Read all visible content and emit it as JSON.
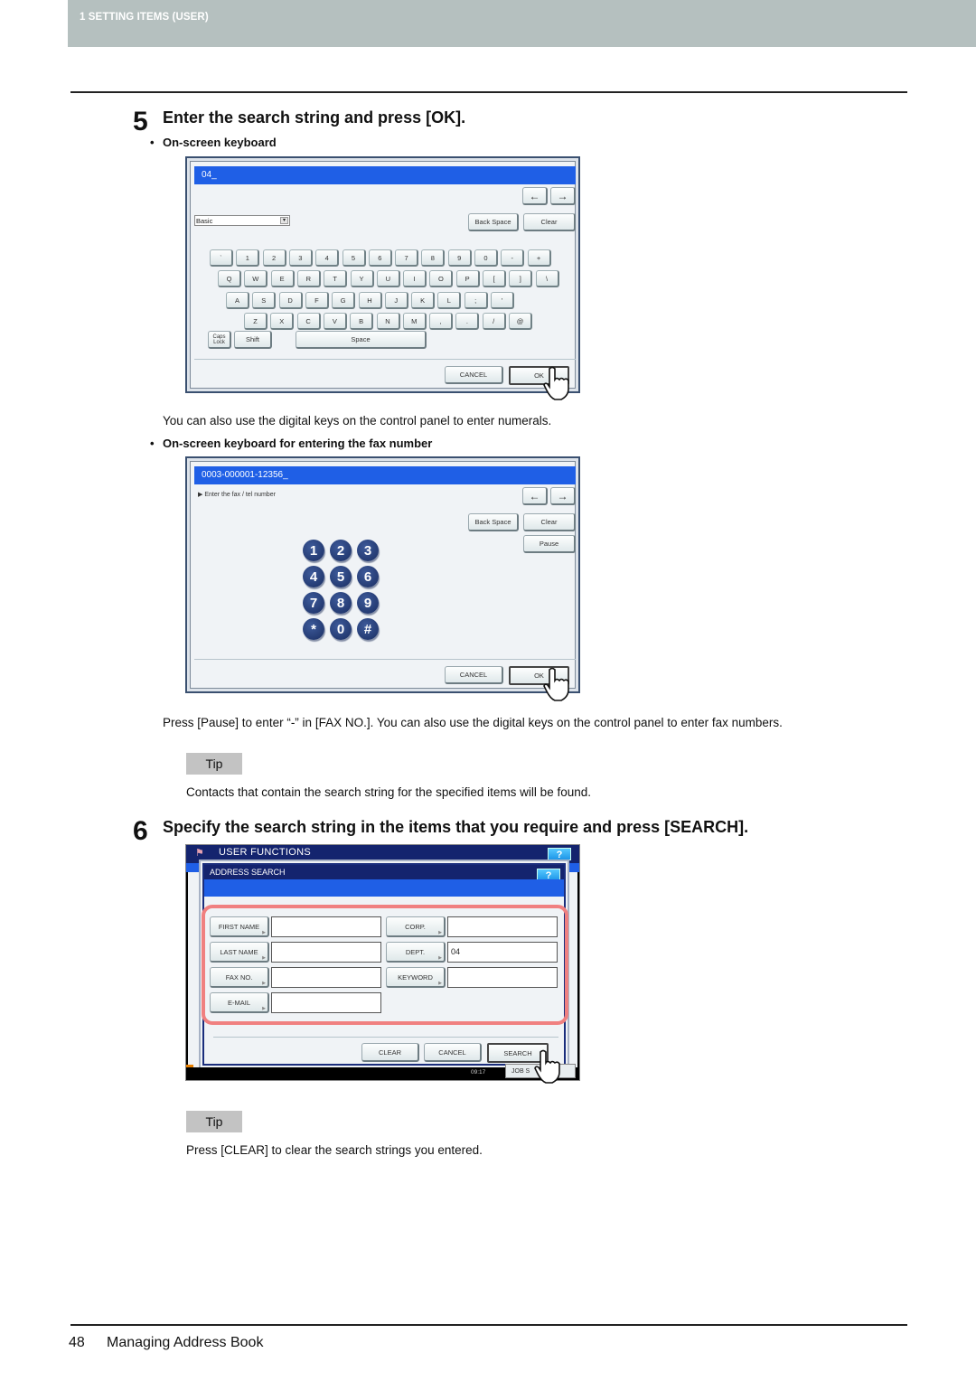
{
  "header": {
    "section": "1 SETTING ITEMS (USER)"
  },
  "step5": {
    "number": "5",
    "title": "Enter the search string and press [OK].",
    "bullet1": "On-screen keyboard",
    "keyboard": {
      "input_value": "04_",
      "mode_select": "Basic",
      "back_space": "Back Space",
      "clear": "Clear",
      "arrow_left": "←",
      "arrow_right": "→",
      "row1": [
        "`",
        "1",
        "2",
        "3",
        "4",
        "5",
        "6",
        "7",
        "8",
        "9",
        "0",
        "-",
        "+"
      ],
      "row2": [
        "Q",
        "W",
        "E",
        "R",
        "T",
        "Y",
        "U",
        "I",
        "O",
        "P",
        "[",
        "]",
        "\\"
      ],
      "row3": [
        "A",
        "S",
        "D",
        "F",
        "G",
        "H",
        "J",
        "K",
        "L",
        ";",
        "'"
      ],
      "row4": [
        "Z",
        "X",
        "C",
        "V",
        "B",
        "N",
        "M",
        ",",
        ".",
        "/",
        "@"
      ],
      "caps_lock": "Caps Lock",
      "shift": "Shift",
      "space": "Space",
      "cancel": "CANCEL",
      "ok": "OK"
    },
    "note1": "You can also use the digital keys on the control panel to enter numerals.",
    "bullet2": "On-screen keyboard for entering the fax number",
    "fax_keyboard": {
      "input_value": "0003-000001-12356_",
      "prompt": "Enter the fax / tel number",
      "back_space": "Back Space",
      "clear": "Clear",
      "pause": "Pause",
      "arrow_left": "←",
      "arrow_right": "→",
      "keys": [
        "1",
        "2",
        "3",
        "4",
        "5",
        "6",
        "7",
        "8",
        "9",
        "*",
        "0",
        "#"
      ],
      "cancel": "CANCEL",
      "ok": "OK"
    },
    "note2": "Press [Pause] to enter “-” in [FAX NO.]. You can also use the digital keys on the control panel to enter fax numbers.",
    "tip_label": "Tip",
    "tip_text": "Contacts that contain the search string for the specified items will be found."
  },
  "step6": {
    "number": "6",
    "title": "Specify the search string in the items that you require and press [SEARCH].",
    "screen": {
      "top_title": "USER FUNCTIONS",
      "help": "?",
      "dialog_title": "ADDRESS SEARCH",
      "fields": [
        {
          "label": "FIRST NAME",
          "value": ""
        },
        {
          "label": "CORP.",
          "value": ""
        },
        {
          "label": "LAST NAME",
          "value": ""
        },
        {
          "label": "DEPT.",
          "value": "04"
        },
        {
          "label": "FAX NO.",
          "value": ""
        },
        {
          "label": "KEYWORD",
          "value": ""
        },
        {
          "label": "E-MAIL",
          "value": ""
        }
      ],
      "clear": "CLEAR",
      "cancel": "CANCEL",
      "search": "SEARCH",
      "time": "09:17",
      "job_status": "JOB S"
    },
    "tip_label": "Tip",
    "tip_text": "Press [CLEAR] to clear the search strings you entered."
  },
  "footer": {
    "page_number": "48",
    "title": "Managing Address Book"
  },
  "colors": {
    "header_bg": "#b5c0bf",
    "input_blue": "#1f5fe6",
    "navy": "#14246e",
    "highlight": "#f08080",
    "tip_bg": "#c3c3c3"
  }
}
